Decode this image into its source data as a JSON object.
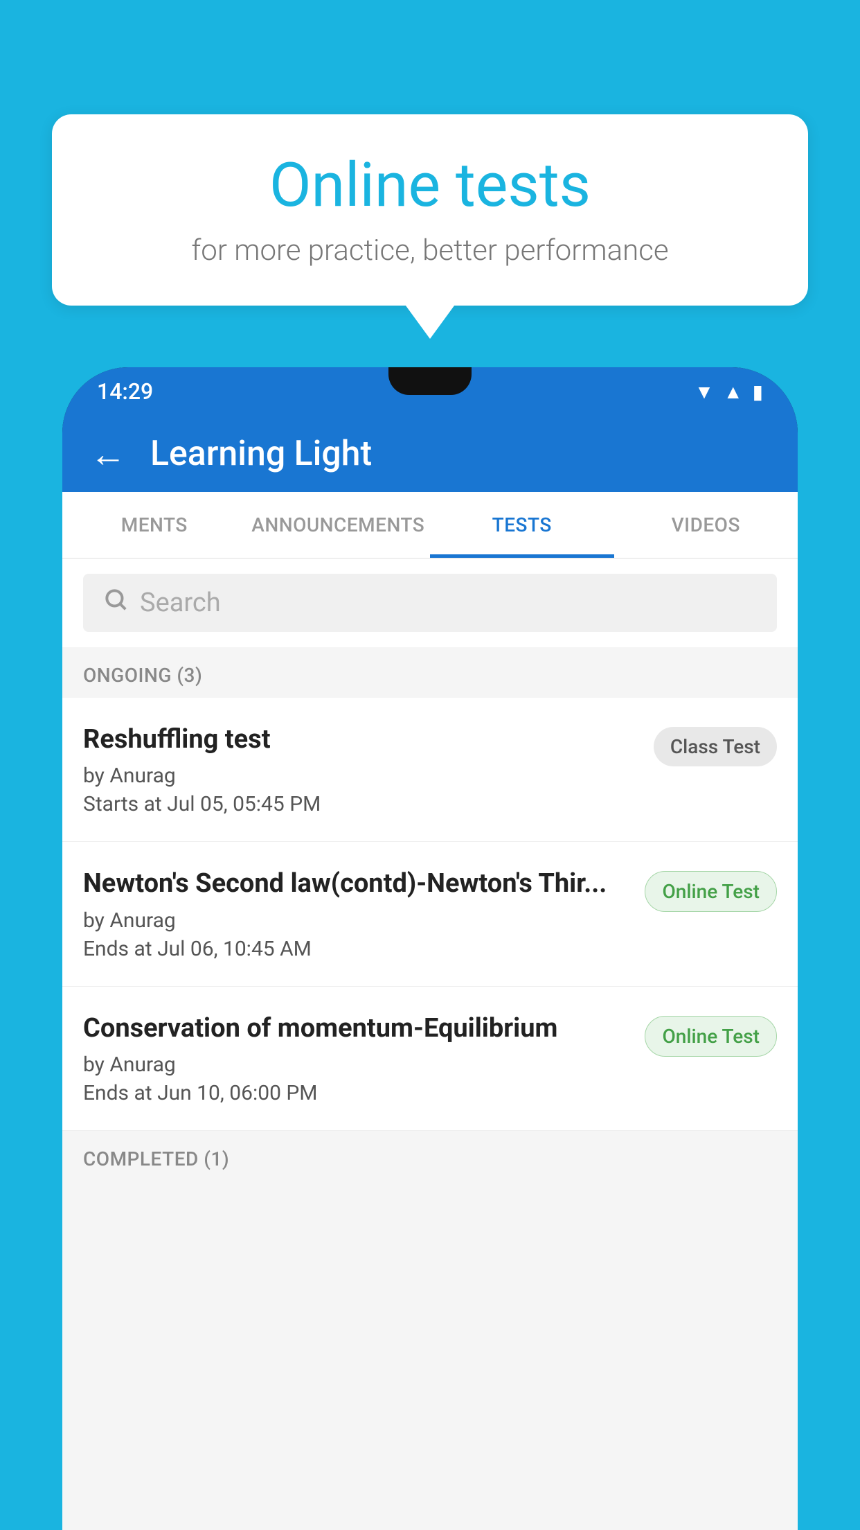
{
  "background": {
    "color": "#1ab4e0"
  },
  "bubble": {
    "title": "Online tests",
    "subtitle": "for more practice, better performance"
  },
  "phone": {
    "status_bar": {
      "time": "14:29",
      "icons": [
        "wifi",
        "signal",
        "battery"
      ]
    },
    "app_bar": {
      "title": "Learning Light",
      "back_label": "←"
    },
    "tabs": [
      {
        "label": "MENTS",
        "active": false
      },
      {
        "label": "ANNOUNCEMENTS",
        "active": false
      },
      {
        "label": "TESTS",
        "active": true
      },
      {
        "label": "VIDEOS",
        "active": false
      }
    ],
    "search": {
      "placeholder": "Search"
    },
    "ongoing_section": {
      "header": "ONGOING (3)",
      "items": [
        {
          "name": "Reshuffling test",
          "author": "by Anurag",
          "time_label": "Starts at",
          "time_value": "Jul 05, 05:45 PM",
          "badge": "Class Test",
          "badge_type": "class"
        },
        {
          "name": "Newton's Second law(contd)-Newton's Thir...",
          "author": "by Anurag",
          "time_label": "Ends at",
          "time_value": "Jul 06, 10:45 AM",
          "badge": "Online Test",
          "badge_type": "online"
        },
        {
          "name": "Conservation of momentum-Equilibrium",
          "author": "by Anurag",
          "time_label": "Ends at",
          "time_value": "Jun 10, 06:00 PM",
          "badge": "Online Test",
          "badge_type": "online"
        }
      ]
    },
    "completed_section": {
      "header": "COMPLETED (1)"
    }
  }
}
